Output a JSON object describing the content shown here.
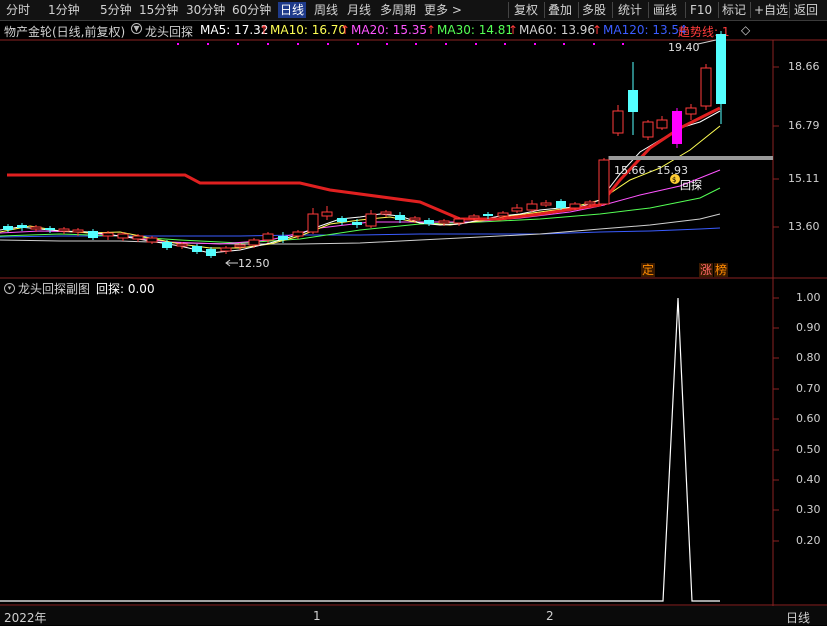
{
  "toolbar": {
    "left_items": [
      "分时",
      "1分钟",
      "5分钟",
      "15分钟",
      "30分钟",
      "60分钟",
      "日线",
      "周线",
      "月线",
      "多周期",
      "更多 >"
    ],
    "active_item": "日线",
    "right_items": [
      "复权",
      "叠加",
      "多股",
      "统计",
      "画线",
      "F10",
      "标记",
      "+自选",
      "返回"
    ]
  },
  "main_header": {
    "stock": "物产金轮(日线,前复权)",
    "indicator": "龙头回探",
    "ma5": "MA5: 17.32",
    "ma10": "MA10: 16.70",
    "ma20": "MA20: 15.35",
    "ma30": "MA30: 14.81",
    "ma60": "MA60: 13.96",
    "ma120": "MA120: 13.54",
    "trend": "趋势线: 1",
    "arrow": "↑",
    "diamond": "◇"
  },
  "price_axis": {
    "labels": [
      "18.66",
      "16.79",
      "15.11",
      "13.60"
    ],
    "values": [
      18.66,
      16.79,
      15.11,
      13.6
    ]
  },
  "annotations": {
    "high": "19.40",
    "low": "12.50",
    "range": "15.66 - 15.93",
    "pullback": "回探",
    "tag_ding": "定",
    "tag_zhang": "涨",
    "tag_bang": "榜"
  },
  "sub_header": {
    "indicator": "龙头回探副图",
    "value": "回探: 0.00"
  },
  "sub_axis": {
    "labels": [
      "1.00",
      "0.90",
      "0.80",
      "0.70",
      "0.60",
      "0.50",
      "0.40",
      "0.30",
      "0.20"
    ]
  },
  "bottom_bar": {
    "year": "2022年",
    "m1": "1",
    "m2": "2",
    "period": "日线"
  },
  "colors": {
    "up": "#ff3b3b",
    "down": "#54ffff",
    "ma5": "#ffffff",
    "ma10": "#ffff54",
    "ma20": "#ff54ff",
    "ma30": "#54ff54",
    "ma60": "#d0d0d0",
    "ma120": "#3a5cff",
    "trend": "#e02020",
    "magenta": "#ff00ff"
  }
}
